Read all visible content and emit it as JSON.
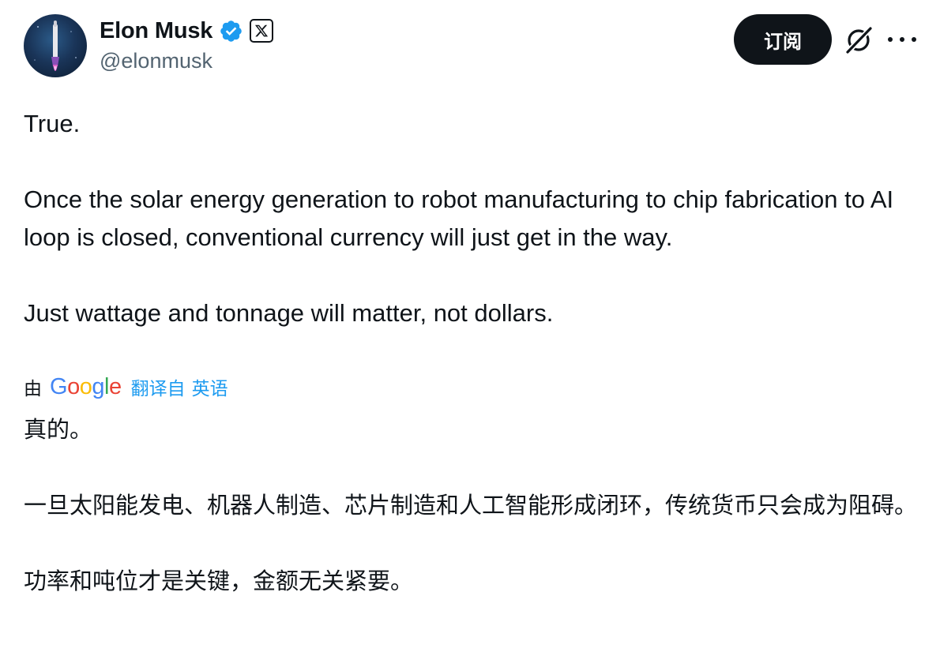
{
  "author": {
    "display_name": "Elon Musk",
    "handle": "@elonmusk",
    "verified_icon": "verified-badge-icon",
    "affiliate_icon": "x-logo-icon"
  },
  "actions": {
    "subscribe_label": "订阅",
    "grok_icon": "grok-icon",
    "more_icon": "more-icon"
  },
  "tweet": {
    "lines": [
      "True.",
      "Once the solar energy generation to robot manufacturing to chip fabrication to AI loop is closed, conventional currency will just get in the way.",
      "Just wattage and tonnage will matter, not dollars."
    ]
  },
  "translation": {
    "by_label": "由",
    "provider": "Google",
    "action_label": "翻译自",
    "source_language": "英语",
    "lines": [
      "真的。",
      "一旦太阳能发电、机器人制造、芯片制造和人工智能形成闭环，传统货币只会成为阻碍。",
      "功率和吨位才是关键，金额无关紧要。"
    ]
  },
  "colors": {
    "text_primary": "#0f1419",
    "text_secondary": "#536471",
    "link_blue": "#1d9bf0",
    "verified_blue": "#1d9bf0",
    "button_bg": "#0f1419"
  }
}
